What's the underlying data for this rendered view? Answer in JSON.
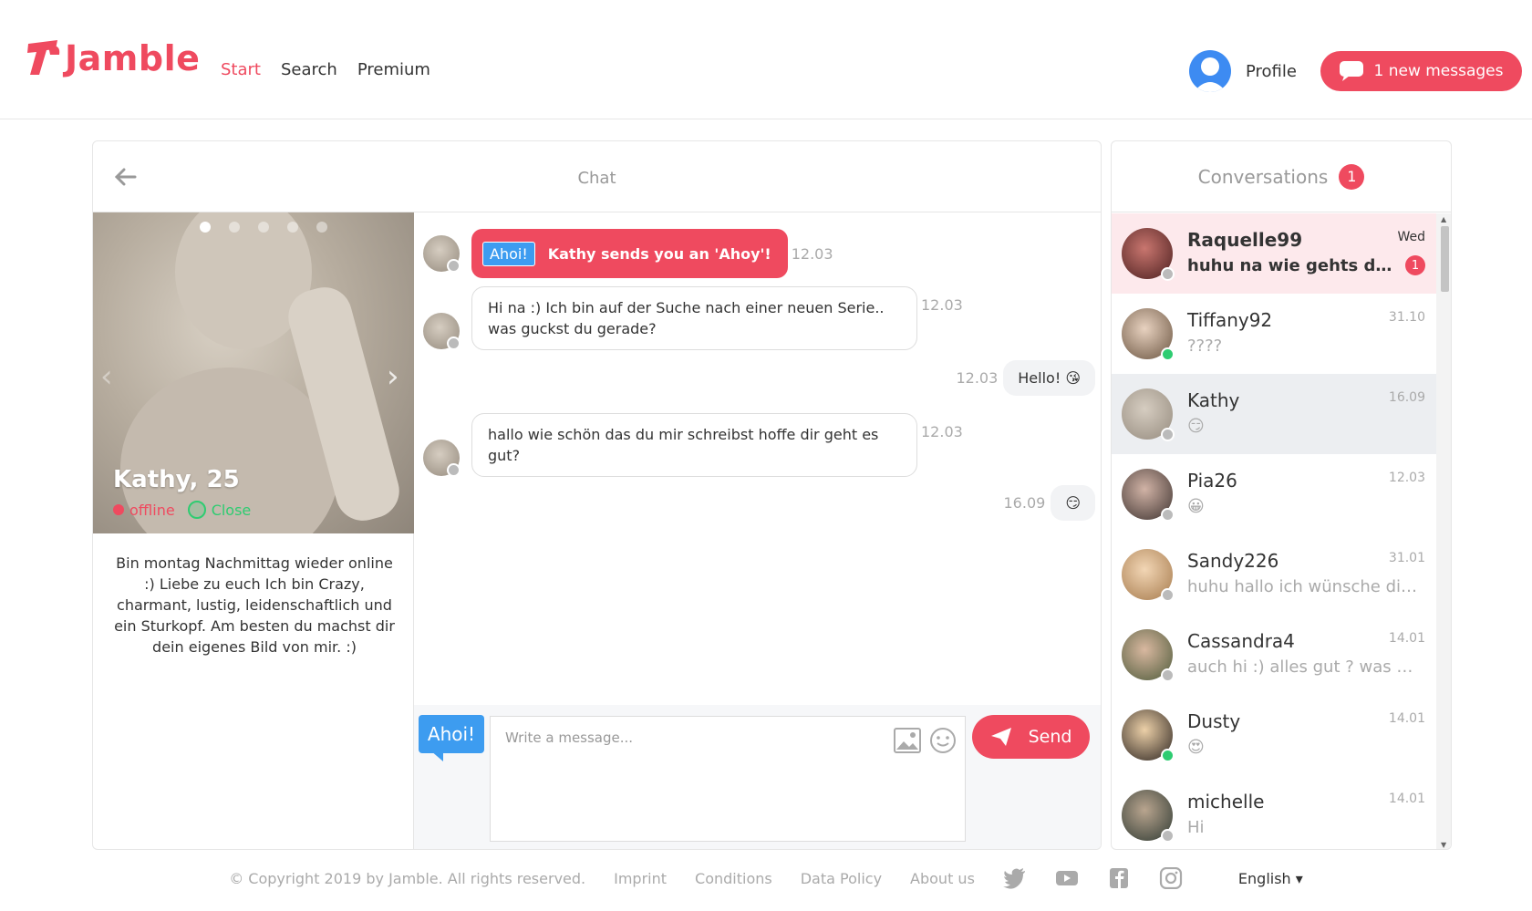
{
  "header": {
    "brand": "Jamble",
    "nav": [
      {
        "label": "Start",
        "active": true
      },
      {
        "label": "Search",
        "active": false
      },
      {
        "label": "Premium",
        "active": false
      }
    ],
    "profile_label": "Profile",
    "new_messages_label": "1 new messages",
    "accent_color": "#ef4a5f"
  },
  "chat": {
    "title": "Chat",
    "profile": {
      "name_age": "Kathy, 25",
      "status": "offline",
      "close_label": "Close",
      "bio": "Bin montag Nachmittag wieder online :) Liebe zu euch Ich bin Crazy, charmant, lustig, leidenschaftlich und ein Sturkopf. Am besten du machst dir dein eigenes Bild von mir. :)",
      "photo_count": 5,
      "photo_index": 1
    },
    "messages": [
      {
        "direction": "in",
        "type": "ahoi",
        "tag": "Ahoi!",
        "text": "Kathy sends you an 'Ahoy'!",
        "time": "12.03"
      },
      {
        "direction": "in",
        "type": "text",
        "text": "Hi na :) Ich bin auf der Suche nach einer neuen Serie.. was guckst du gerade?",
        "time": "12.03"
      },
      {
        "direction": "out",
        "type": "text",
        "text": "Hello! 😘",
        "time": "12.03"
      },
      {
        "direction": "in",
        "type": "text",
        "text": "hallo wie schön das du mir schreibst hoffe dir geht es gut?",
        "time": "12.03"
      },
      {
        "direction": "out",
        "type": "text",
        "text": "😏",
        "time": "16.09"
      }
    ],
    "composer": {
      "ahoi_label": "Ahoi!",
      "placeholder": "Write a message...",
      "send_label": "Send"
    }
  },
  "conversations": {
    "title": "Conversations",
    "unread_count": "1",
    "items": [
      {
        "name": "Raquelle99",
        "date": "Wed",
        "preview": "huhu na wie gehts denn...",
        "unread": "1",
        "online": false,
        "state": "unread"
      },
      {
        "name": "Tiffany92",
        "date": "31.10",
        "preview": "????",
        "online": true,
        "state": "normal"
      },
      {
        "name": "Kathy",
        "date": "16.09",
        "preview": "😏",
        "online": false,
        "state": "selected"
      },
      {
        "name": "Pia26",
        "date": "12.03",
        "preview": "😀",
        "online": false,
        "state": "normal"
      },
      {
        "name": "Sandy226",
        "date": "31.01",
        "preview": "huhu hallo ich wünsche dir ...",
        "online": false,
        "state": "normal"
      },
      {
        "name": "Cassandra4",
        "date": "14.01",
        "preview": "auch hi :) alles gut ? was ma...",
        "online": false,
        "state": "normal"
      },
      {
        "name": "Dusty",
        "date": "14.01",
        "preview": "😍",
        "online": true,
        "state": "normal"
      },
      {
        "name": "michelle",
        "date": "14.01",
        "preview": "Hi",
        "online": false,
        "state": "normal"
      }
    ]
  },
  "footer": {
    "copyright": "© Copyright 2019 by Jamble. All rights reserved.",
    "links": [
      "Imprint",
      "Conditions",
      "Data Policy",
      "About us"
    ],
    "social": [
      "twitter-icon",
      "youtube-icon",
      "facebook-icon",
      "instagram-icon"
    ],
    "language": "English ▾"
  }
}
